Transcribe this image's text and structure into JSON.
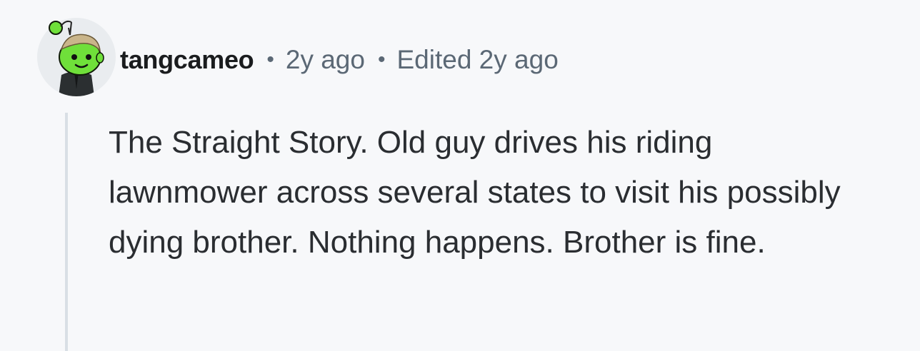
{
  "comment": {
    "username": "tangcameo",
    "separator": "•",
    "timestamp": "2y ago",
    "edited": "Edited 2y ago",
    "body": "The Straight Story. Old guy drives his riding lawnmower across several states to visit his possibly dying brother. Nothing happens. Brother is fine.",
    "avatar_icon": "snoo-avatar-icon"
  },
  "colors": {
    "background": "#f7f8fa",
    "username": "#1a1c1e",
    "meta": "#5b6875",
    "body": "#2a2d31",
    "thread_line": "#d9dfe5",
    "avatar_green": "#7ee23a"
  }
}
